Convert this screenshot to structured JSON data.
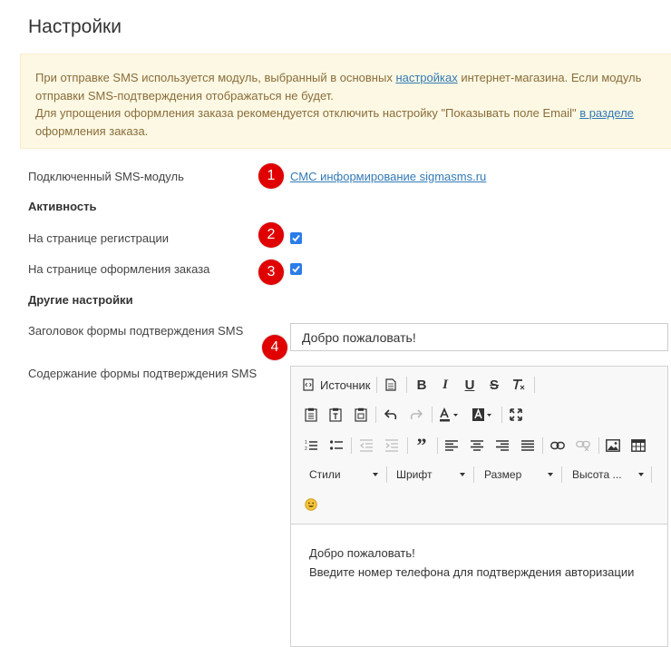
{
  "page": {
    "title": "Настройки"
  },
  "notice": {
    "line1_before": "При отправке SMS используется модуль, выбранный в основных ",
    "line1_link": "настройках",
    "line1_after": " интернет-магазина. Если модуль",
    "line2": "отправки SMS-подтверждения отображаться не будет.",
    "line3_before": "Для упрощения оформления заказа рекомендуется отключить настройку \"Показывать поле Email\" ",
    "line3_link": "в разделе",
    "line4": "оформления заказа."
  },
  "form": {
    "sms_module_label": "Подключенный SMS-модуль",
    "sms_module_link": "СМС информирование sigmasms.ru",
    "activity_heading": "Активность",
    "registration_label": "На странице регистрации",
    "registration_checked": true,
    "checkout_label": "На странице оформления заказа",
    "checkout_checked": true,
    "other_heading": "Другие настройки",
    "title_label": "Заголовок формы подтверждения SMS",
    "title_value": "Добро пожаловать!",
    "content_label": "Содержание формы подтверждения SMS"
  },
  "badges": [
    "1",
    "2",
    "3",
    "4"
  ],
  "editor": {
    "source_label": "Источник",
    "styles_label": "Стили",
    "font_label": "Шрифт",
    "size_label": "Размер",
    "height_label": "Высота ...",
    "content_line1": "Добро пожаловать!",
    "content_line2": "Введите номер телефона для подтверждения авторизации"
  },
  "colors": {
    "accent": "#2b7de9",
    "link": "#337ab7",
    "badge": "#e00000",
    "notice_bg": "#fcf8e3"
  }
}
